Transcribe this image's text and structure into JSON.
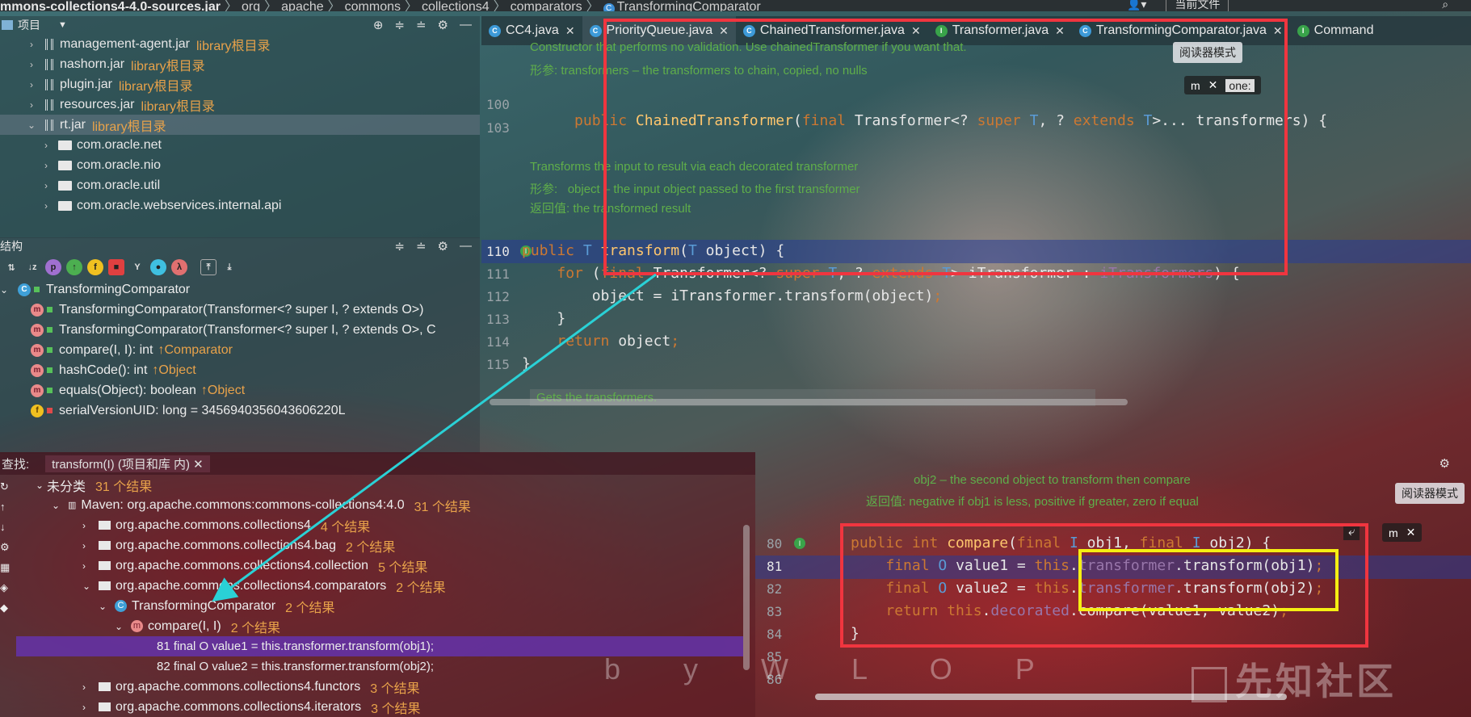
{
  "breadcrumb": {
    "items": [
      "mmons-collections4-4.0-sources.jar",
      "org",
      "apache",
      "commons",
      "collections4",
      "comparators",
      "TransformingComparator"
    ]
  },
  "topbar_right": {
    "scope": "当前文件"
  },
  "project": {
    "title": "项目",
    "rows": [
      {
        "name": "management-agent.jar",
        "suffix": "library根目录",
        "kind": "jar"
      },
      {
        "name": "nashorn.jar",
        "suffix": "library根目录",
        "kind": "jar"
      },
      {
        "name": "plugin.jar",
        "suffix": "library根目录",
        "kind": "jar"
      },
      {
        "name": "resources.jar",
        "suffix": "library根目录",
        "kind": "jar"
      },
      {
        "name": "rt.jar",
        "suffix": "library根目录",
        "kind": "jar-open"
      },
      {
        "name": "com.oracle.net",
        "suffix": "",
        "kind": "pkg"
      },
      {
        "name": "com.oracle.nio",
        "suffix": "",
        "kind": "pkg"
      },
      {
        "name": "com.oracle.util",
        "suffix": "",
        "kind": "pkg"
      },
      {
        "name": "com.oracle.webservices.internal.api",
        "suffix": "",
        "kind": "pkg"
      }
    ]
  },
  "structure": {
    "title": "结构",
    "root": "TransformingComparator",
    "members": [
      {
        "text": "TransformingComparator(Transformer<? super I, ? extends O>)",
        "extra": ""
      },
      {
        "text": "TransformingComparator(Transformer<? super I, ? extends O>, C",
        "extra": ""
      },
      {
        "text": "compare(I, I): int",
        "extra": "↑Comparator"
      },
      {
        "text": "hashCode(): int",
        "extra": "↑Object"
      },
      {
        "text": "equals(Object): boolean",
        "extra": "↑Object"
      },
      {
        "text": "serialVersionUID: long = 3456940356043606220L",
        "extra": ""
      }
    ]
  },
  "tabs": [
    {
      "label": "CC4.java",
      "color": "blue"
    },
    {
      "label": "PriorityQueue.java",
      "color": "blue",
      "active": true
    },
    {
      "label": "ChainedTransformer.java",
      "color": "blue"
    },
    {
      "label": "Transformer.java",
      "color": "green"
    },
    {
      "label": "TransformingComparator.java",
      "color": "blue"
    },
    {
      "label": "Command",
      "color": "green"
    }
  ],
  "editor_top": {
    "reader_mode": "阅读器模式",
    "doc1": "Constructor that performs no validation. Use chainedTransformer if you want that.",
    "doc1_param_label": "形参:",
    "doc1_param": "transformers – the transformers to chain, copied, no nulls",
    "line100": "100",
    "line103": "103",
    "constructor": "public ChainedTransformer(final Transformer<? super T, ? extends T>... transformers) {",
    "doc2": "Transforms the input to result via each decorated transformer",
    "doc2_param_label": "形参:",
    "doc2_param": "object – the input object passed to the first transformer",
    "doc2_ret_label": "返回值:",
    "doc2_ret": "the transformed result",
    "line110": "110",
    "line111": "111",
    "line112": "112",
    "line113": "113",
    "line114": "114",
    "line115": "115",
    "code110": "public T transform(T object) {",
    "code111": "    for (final Transformer<? super T, ? extends T> iTransformer : iTransformers) {",
    "code112": "        object = iTransformer.transform(object);",
    "code113": "    }",
    "code114": "    return object;",
    "code115": "}",
    "doc3": "Gets the transformers.",
    "float_hint": "one:"
  },
  "find": {
    "label": "查找:",
    "tab": "transform(I) (项目和库 内)",
    "rows": [
      {
        "indent": 0,
        "text": "未分类",
        "count": "31 个结果"
      },
      {
        "indent": 1,
        "text": "Maven: org.apache.commons:commons-collections4:4.0",
        "count": "31 个结果"
      },
      {
        "indent": 2,
        "text": "org.apache.commons.collections4",
        "count": "4 个结果"
      },
      {
        "indent": 2,
        "text": "org.apache.commons.collections4.bag",
        "count": "2 个结果"
      },
      {
        "indent": 2,
        "text": "org.apache.commons.collections4.collection",
        "count": "5 个结果"
      },
      {
        "indent": 2,
        "text": "org.apache.commons.collections4.comparators",
        "count": "2 个结果"
      },
      {
        "indent": 3,
        "text": "TransformingComparator",
        "count": "2 个结果"
      },
      {
        "indent": 4,
        "text": "compare(I, I)",
        "count": "2 个结果"
      },
      {
        "indent": 5,
        "text": "81 final O value1 = this.transformer.transform(obj1);",
        "count": "",
        "sel": true
      },
      {
        "indent": 5,
        "text": "82 final O value2 = this.transformer.transform(obj2);",
        "count": ""
      },
      {
        "indent": 2,
        "text": "org.apache.commons.collections4.functors",
        "count": "3 个结果"
      },
      {
        "indent": 2,
        "text": "org.apache.commons.collections4.iterators",
        "count": "3 个结果"
      }
    ]
  },
  "editor_bottom": {
    "reader_mode": "阅读器模式",
    "doc_param": "obj2 – the second object to transform then compare",
    "doc_ret_label": "返回值:",
    "doc_ret": "negative if obj1 is less, positive if greater, zero if equal",
    "line80": "80",
    "line81": "81",
    "line82": "82",
    "line83": "83",
    "line84": "84",
    "line85": "85",
    "line86": "86",
    "code80": "public int compare(final I obj1, final I obj2) {",
    "code81": "    final O value1 = this.transformer.transform(obj1);",
    "code82": "    final O value2 = this.transformer.transform(obj2);",
    "code83": "    return this.decorated.compare(value1, value2);",
    "code84": "}"
  },
  "watermark": "先知社区",
  "art_signature": "b y W L O P",
  "colors": {
    "highlight_red": "#f0353f",
    "highlight_yellow": "#f5ef12",
    "arrow": "#2ad1d6",
    "selection": "#6432aa"
  }
}
